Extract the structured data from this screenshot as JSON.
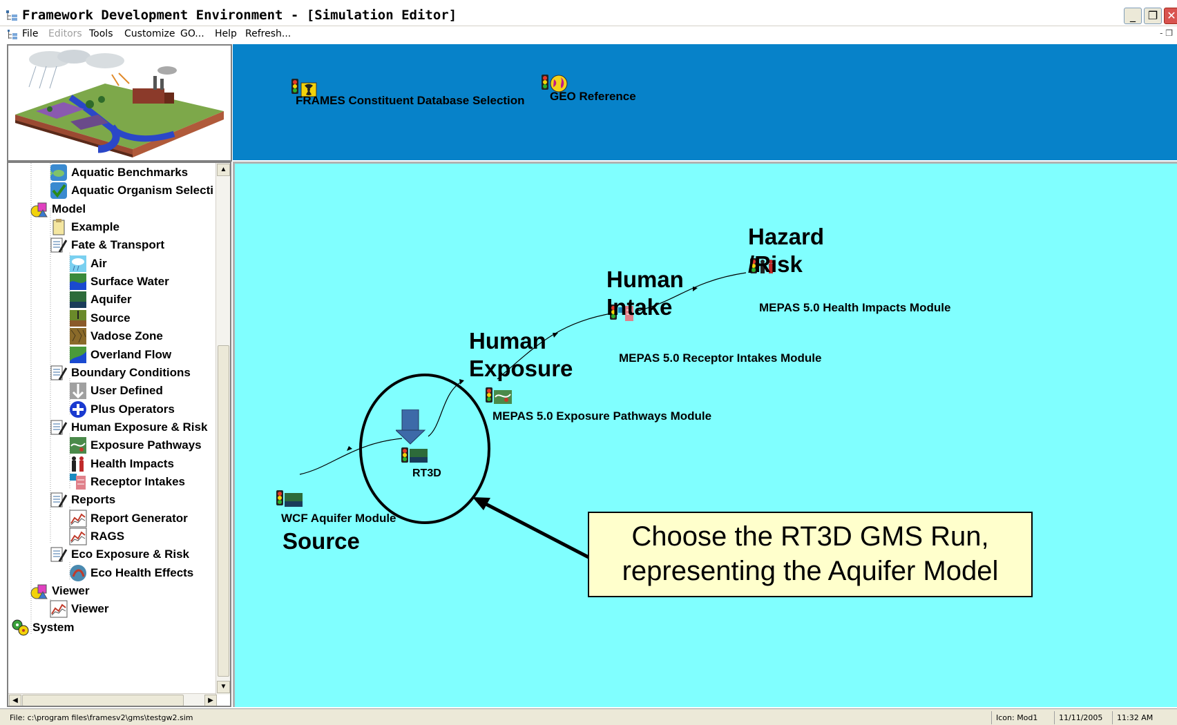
{
  "window": {
    "title": "Framework Development Environment - [Simulation Editor]",
    "buttons": {
      "minimize": "_",
      "restore": "❐",
      "close": "✕"
    }
  },
  "menu": {
    "items": [
      {
        "label": "File",
        "enabled": true
      },
      {
        "label": "Editors",
        "enabled": false
      },
      {
        "label": "Tools",
        "enabled": true
      },
      {
        "label": "Customize",
        "enabled": true
      },
      {
        "label": "GO...",
        "enabled": true
      },
      {
        "label": "Help",
        "enabled": true
      },
      {
        "label": "Refresh...",
        "enabled": true
      }
    ],
    "mdi_controls": "- ❐"
  },
  "top_panel": {
    "modules": [
      {
        "label": "FRAMES Constituent Database Selection",
        "icon": "radiation-database-icon"
      },
      {
        "label": "GEO Reference",
        "icon": "globe-icon"
      }
    ]
  },
  "tree": {
    "items": [
      {
        "label": "Aquatic Benchmarks",
        "icon": "fish-check-icon",
        "level": 2
      },
      {
        "label": "Aquatic Organism Selecti",
        "icon": "checkmark-icon",
        "level": 2
      },
      {
        "label": "Model",
        "icon": "shapes-folder-icon",
        "level": 1
      },
      {
        "label": "Example",
        "icon": "clipboard-icon",
        "level": 2
      },
      {
        "label": "Fate & Transport",
        "icon": "document-pencil-icon",
        "level": 2
      },
      {
        "label": "Air",
        "icon": "air-cloud-icon",
        "level": 3
      },
      {
        "label": "Surface Water",
        "icon": "surface-water-icon",
        "level": 3
      },
      {
        "label": "Aquifer",
        "icon": "aquifer-icon",
        "level": 3
      },
      {
        "label": "Source",
        "icon": "source-icon",
        "level": 3
      },
      {
        "label": "Vadose Zone",
        "icon": "vadose-zone-icon",
        "level": 3
      },
      {
        "label": "Overland Flow",
        "icon": "overland-flow-icon",
        "level": 3
      },
      {
        "label": "Boundary Conditions",
        "icon": "document-pencil-icon",
        "level": 2
      },
      {
        "label": "User Defined",
        "icon": "user-defined-icon",
        "level": 3
      },
      {
        "label": "Plus Operators",
        "icon": "plus-circle-icon",
        "level": 3
      },
      {
        "label": "Human Exposure & Risk",
        "icon": "document-pencil-icon",
        "level": 2
      },
      {
        "label": "Exposure Pathways",
        "icon": "exposure-pathways-icon",
        "level": 3
      },
      {
        "label": "Health Impacts",
        "icon": "people-icon",
        "level": 3
      },
      {
        "label": "Receptor Intakes",
        "icon": "receptor-intakes-icon",
        "level": 3
      },
      {
        "label": "Reports",
        "icon": "document-pencil-icon",
        "level": 2
      },
      {
        "label": "Report Generator",
        "icon": "line-graph-icon",
        "level": 3
      },
      {
        "label": "RAGS",
        "icon": "line-graph-icon",
        "level": 3
      },
      {
        "label": "Eco Exposure & Risk",
        "icon": "document-pencil-icon",
        "level": 2
      },
      {
        "label": "Eco Health Effects",
        "icon": "eco-health-icon",
        "level": 3
      },
      {
        "label": "Viewer",
        "icon": "shapes-folder-icon",
        "level": 1
      },
      {
        "label": "Viewer",
        "icon": "line-graph-icon",
        "level": 2
      },
      {
        "label": "System",
        "icon": "system-gears-icon",
        "level": 0
      }
    ]
  },
  "canvas": {
    "nodes": [
      {
        "id": "wcf",
        "label": "WCF Aquifer Module"
      },
      {
        "id": "rt3d",
        "label": "RT3D"
      },
      {
        "id": "exposure",
        "label": "MEPAS 5.0 Exposure Pathways Module"
      },
      {
        "id": "intake",
        "label": "MEPAS 5.0 Receptor Intakes Module"
      },
      {
        "id": "health",
        "label": "MEPAS 5.0 Health Impacts Module"
      }
    ],
    "stage_labels": {
      "source": "Source",
      "exposure_1": "Human",
      "exposure_2": "Exposure",
      "intake_1": "Human",
      "intake_2": "Intake",
      "hazard_1": "Hazard",
      "hazard_2": "/Risk"
    },
    "callout": {
      "line1": "Choose the RT3D GMS Run,",
      "line2": "representing the Aquifer Model"
    },
    "colors": {
      "background": "#80ffff",
      "callout_fill": "#ffffcc",
      "down_arrow": "#3d6aa8"
    }
  },
  "status": {
    "file": "File: c:\\program files\\framesv2\\gms\\testgw2.sim",
    "icon": "Icon: Mod1",
    "date": "11/11/2005",
    "time": "11:32 AM"
  },
  "colors": {
    "top_panel": "#0782c9",
    "canvas": "#80ffff"
  }
}
